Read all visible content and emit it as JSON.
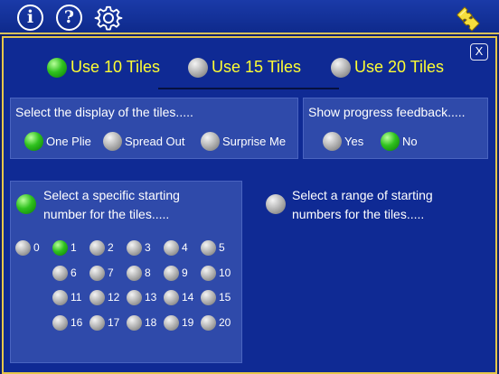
{
  "toolbar": {
    "info_label": "i",
    "help_label": "?",
    "settings_icon": "gear-icon",
    "puzzle_icon": "puzzle-piece-icon"
  },
  "close_label": "X",
  "tile_count": {
    "options": [
      {
        "label": "Use 10 Tiles",
        "selected": true
      },
      {
        "label": "Use 15 Tiles",
        "selected": false
      },
      {
        "label": "Use 20 Tiles",
        "selected": false
      }
    ]
  },
  "display": {
    "title": "Select the display of the tiles.....",
    "options": [
      {
        "label": "One Plie",
        "selected": true
      },
      {
        "label": "Spread Out",
        "selected": false
      },
      {
        "label": "Surprise Me",
        "selected": false
      }
    ]
  },
  "feedback": {
    "title": "Show progress feedback.....",
    "options": [
      {
        "label": "Yes",
        "selected": false
      },
      {
        "label": "No",
        "selected": true
      }
    ]
  },
  "starting": {
    "specific_label_line1": "Select a specific starting",
    "specific_label_line2": "number for the tiles.....",
    "specific_selected": true,
    "range_label_line1": "Select a range of starting",
    "range_label_line2": "numbers for the tiles.....",
    "range_selected": false,
    "numbers": [
      {
        "label": "0",
        "selected": false
      },
      {
        "label": "1",
        "selected": true
      },
      {
        "label": "2",
        "selected": false
      },
      {
        "label": "3",
        "selected": false
      },
      {
        "label": "4",
        "selected": false
      },
      {
        "label": "5",
        "selected": false
      },
      {
        "label": "6",
        "selected": false
      },
      {
        "label": "7",
        "selected": false
      },
      {
        "label": "8",
        "selected": false
      },
      {
        "label": "9",
        "selected": false
      },
      {
        "label": "10",
        "selected": false
      },
      {
        "label": "11",
        "selected": false
      },
      {
        "label": "12",
        "selected": false
      },
      {
        "label": "13",
        "selected": false
      },
      {
        "label": "14",
        "selected": false
      },
      {
        "label": "15",
        "selected": false
      },
      {
        "label": "16",
        "selected": false
      },
      {
        "label": "17",
        "selected": false
      },
      {
        "label": "18",
        "selected": false
      },
      {
        "label": "19",
        "selected": false
      },
      {
        "label": "20",
        "selected": false
      }
    ]
  },
  "colors": {
    "background": "#0f2a94",
    "section_box": "#2f4aaa",
    "accent_yellow": "#ffff33",
    "border_gold": "#e6c74a",
    "radio_selected": "#2fc21e",
    "radio_unselected": "#b8b8b8"
  }
}
